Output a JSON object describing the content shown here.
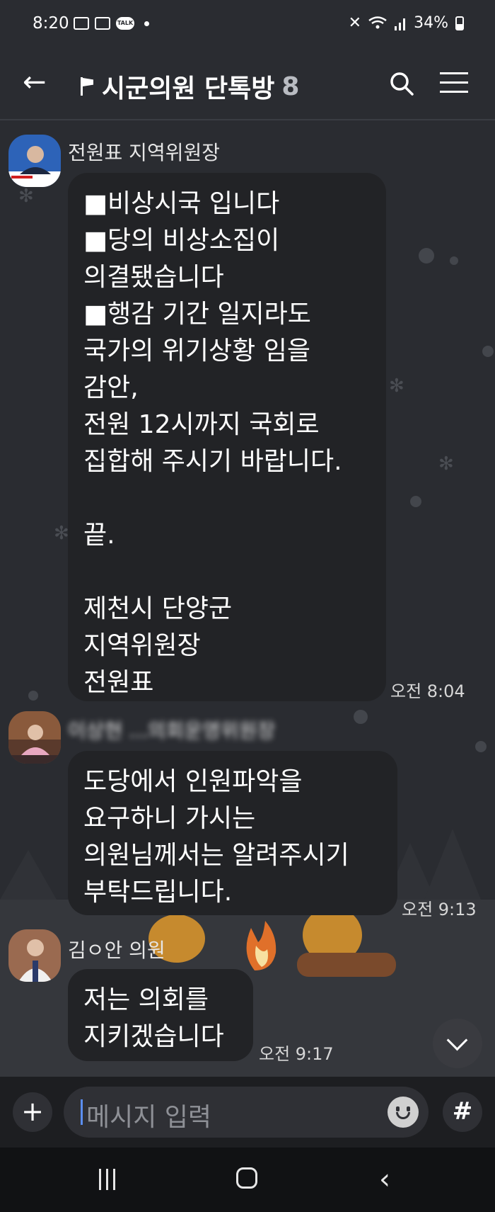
{
  "status_bar": {
    "time": "8:20",
    "battery": "34%"
  },
  "header": {
    "title": "시군의원 단톡방",
    "member_count": "8"
  },
  "messages": [
    {
      "sender": "전원표 지역위원장",
      "text": "■비상시국 입니다\n■당의 비상소집이\n의결됐습니다\n■행감 기간 일지라도\n국가의 위기상황 임을\n감안,\n전원 12시까지 국회로\n집합해 주시기 바랍니다.\n\n끝.\n\n제천시 단양군\n지역위원장\n전원표",
      "time": "오전 8:04"
    },
    {
      "sender": "이상현 ...의회운영위원장",
      "text": "도당에서 인원파악을\n요구하니 가시는\n의원님께서는 알려주시기\n부탁드립니다.",
      "time": "오전 9:13"
    },
    {
      "sender": "김ㅇ안 의원",
      "text": "저는 의회를\n지키겠습니다",
      "time": "오전 9:17"
    }
  ],
  "input": {
    "placeholder": "메시지 입력"
  }
}
